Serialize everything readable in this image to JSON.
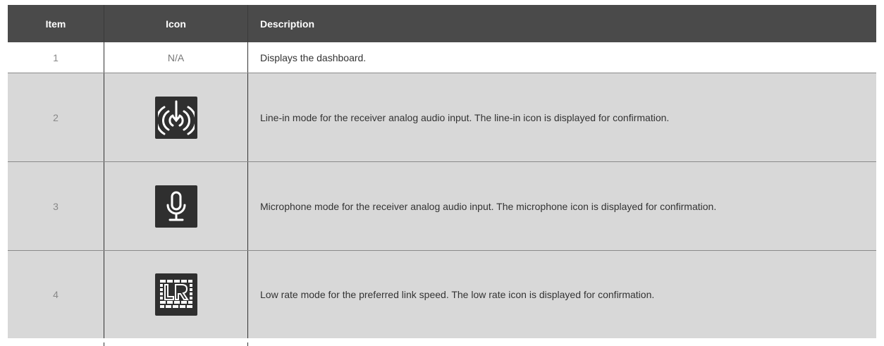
{
  "table": {
    "headers": {
      "item": "Item",
      "icon": "Icon",
      "description": "Description"
    },
    "rows": [
      {
        "item": "1",
        "icon_text": "N/A",
        "icon": "",
        "description": "Displays the dashboard."
      },
      {
        "item": "2",
        "icon_text": "",
        "icon": "line-in-icon",
        "description": "Line-in mode for the receiver analog audio input. The line-in icon is displayed for confirmation."
      },
      {
        "item": "3",
        "icon_text": "",
        "icon": "microphone-icon",
        "description": "Microphone mode for the receiver analog audio input. The microphone icon is displayed for confirmation."
      },
      {
        "item": "4",
        "icon_text": "",
        "icon": "low-rate-icon",
        "description": "Low rate mode for the preferred link speed. The low rate icon is displayed for confirmation."
      }
    ]
  },
  "colors": {
    "header_bg": "#4a4a4a",
    "shaded_row_bg": "#d8d8d8",
    "icon_bg": "#2f2f2f"
  }
}
